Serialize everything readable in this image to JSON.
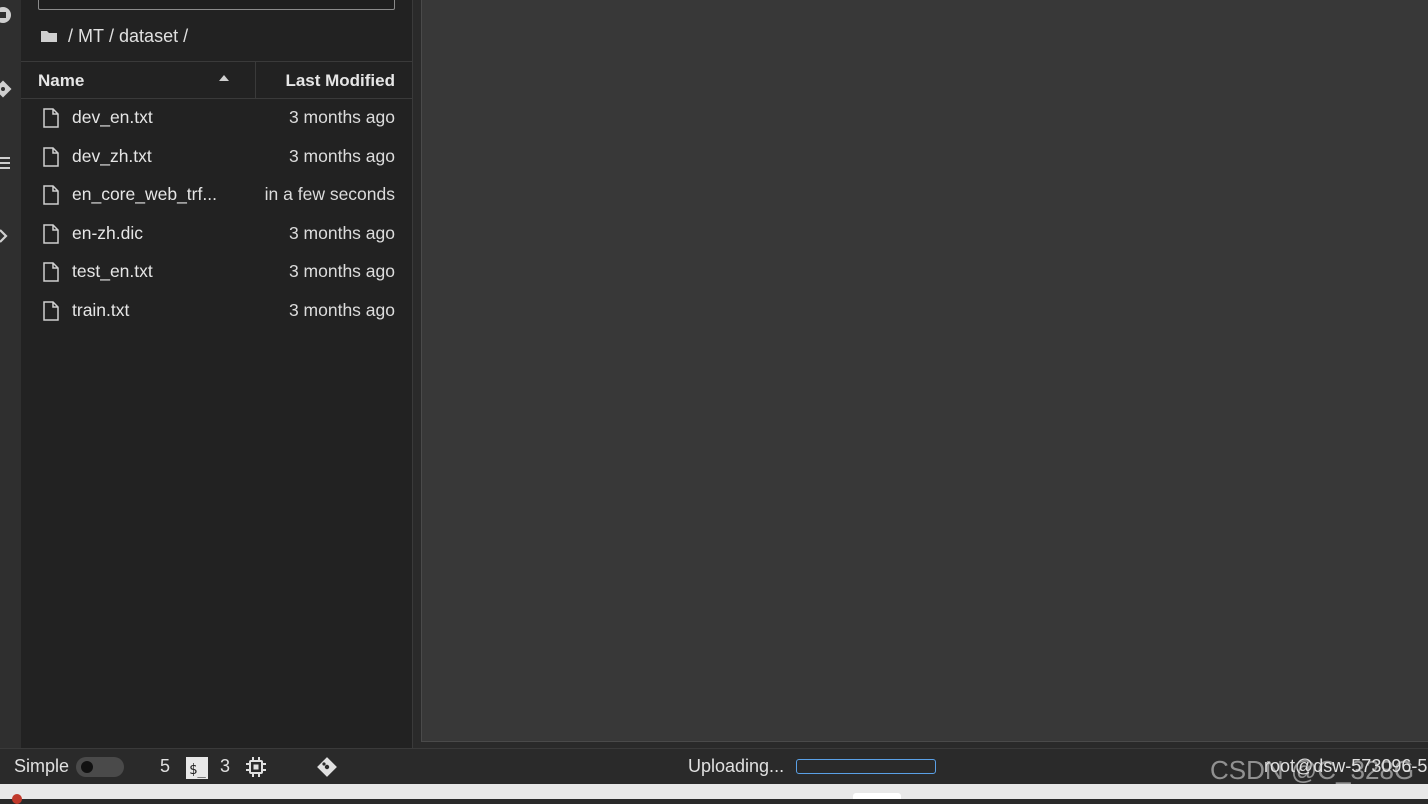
{
  "breadcrumb": {
    "root": " / ",
    "parts": [
      "MT",
      " / ",
      "dataset",
      " /"
    ]
  },
  "columns": {
    "name": "Name",
    "modified": "Last Modified"
  },
  "files": [
    {
      "name": "dev_en.txt",
      "modified": "3 months ago"
    },
    {
      "name": "dev_zh.txt",
      "modified": "3 months ago"
    },
    {
      "name": "en_core_web_trf...",
      "modified": "in a few seconds"
    },
    {
      "name": "en-zh.dic",
      "modified": "3 months ago"
    },
    {
      "name": "test_en.txt",
      "modified": "3 months ago"
    },
    {
      "name": "train.txt",
      "modified": "3 months ago"
    }
  ],
  "status": {
    "mode_label": "Simple",
    "count1": "5",
    "count2": "3",
    "upload_text": "Uploading...",
    "host_text": "root@dsw-573096-5"
  },
  "watermark": "CSDN @C_328G",
  "icons": {
    "activity": [
      "running-icon",
      "git-icon",
      "toc-icon",
      "extension-icon"
    ],
    "file": "file-icon",
    "folder": "folder-icon",
    "terminal": "terminal-icon",
    "kernel": "cpu-icon",
    "git": "git-icon"
  },
  "colors": {
    "accent": "#5aa0e6",
    "panel": "#222222",
    "editor": "#383838"
  }
}
